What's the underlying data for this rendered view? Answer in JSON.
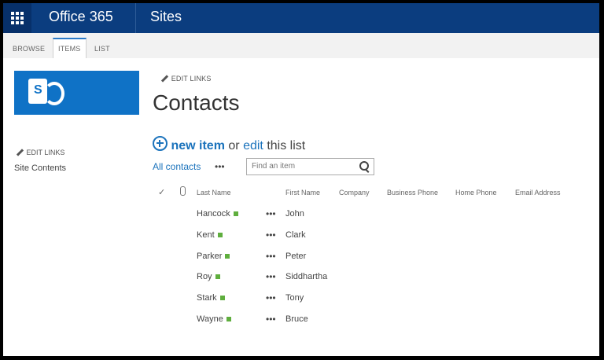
{
  "suite": {
    "app_title": "Office 365",
    "section": "Sites"
  },
  "ribbon": {
    "tabs": [
      "BROWSE",
      "ITEMS",
      "LIST"
    ]
  },
  "left_nav": {
    "edit_links": "EDIT LINKS",
    "site_contents": "Site Contents"
  },
  "page": {
    "edit_links": "EDIT LINKS",
    "title": "Contacts",
    "new_item": "new item",
    "or": "or",
    "edit": "edit",
    "this_list": "this list",
    "view": "All contacts",
    "view_menu": "•••",
    "search_placeholder": "Find an item"
  },
  "table": {
    "columns": [
      "Last Name",
      "First Name",
      "Company",
      "Business Phone",
      "Home Phone",
      "Email Address"
    ],
    "rows": [
      {
        "last": "Hancock",
        "first": "John"
      },
      {
        "last": "Kent",
        "first": "Clark"
      },
      {
        "last": "Parker",
        "first": "Peter"
      },
      {
        "last": "Roy",
        "first": "Siddhartha"
      },
      {
        "last": "Stark",
        "first": "Tony"
      },
      {
        "last": "Wayne",
        "first": "Bruce"
      }
    ],
    "row_menu": "•••"
  },
  "colors": {
    "suite_bar": "#0b3d7f",
    "accent": "#1b73bc",
    "logo": "#0f72c6",
    "new_marker": "#5fae3e"
  }
}
